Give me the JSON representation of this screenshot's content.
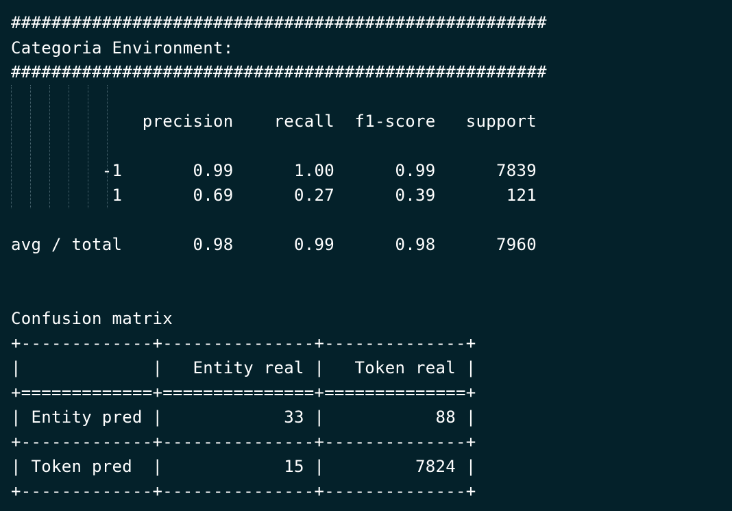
{
  "terminal": {
    "separator_top": "#####################################################",
    "category_title": "Categoria Environment:",
    "separator_bottom": "#####################################################",
    "report": {
      "header_line": "             precision    recall  f1-score   support",
      "rows": [
        "         -1       0.99      1.00      0.99      7839",
        "          1       0.69      0.27      0.39       121"
      ],
      "avg_line": "avg / total       0.98      0.99      0.98      7960"
    },
    "confusion": {
      "title": "Confusion matrix",
      "lines": [
        "+-------------+---------------+--------------+",
        "|             |   Entity real |   Token real |",
        "+=============+===============+==============+",
        "| Entity pred |            33 |           88 |",
        "+-------------+---------------+--------------+",
        "| Token pred  |            15 |         7824 |",
        "+-------------+---------------+--------------+"
      ]
    }
  }
}
